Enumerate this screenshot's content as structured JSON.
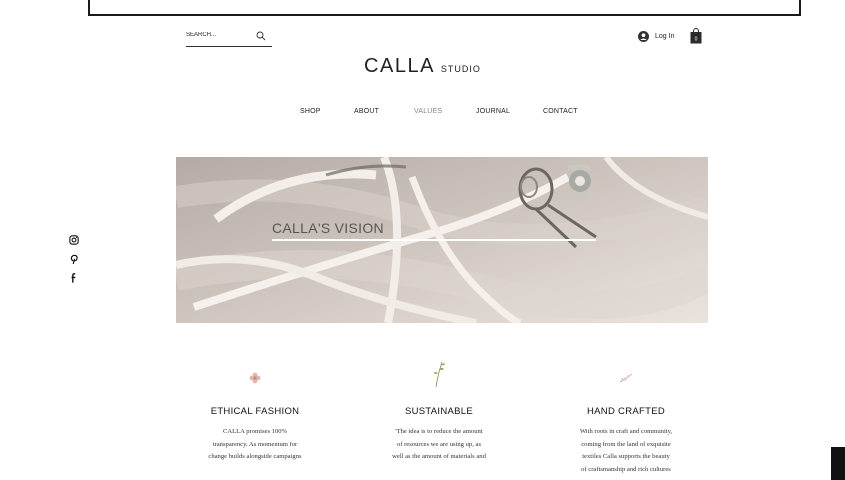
{
  "header": {
    "search_placeholder": "SEARCH...",
    "logo_main": "CALLA",
    "logo_sub": "STUDIO",
    "login_label": "Log In",
    "cart_count": "0"
  },
  "nav": {
    "items": [
      {
        "label": "SHOP"
      },
      {
        "label": "ABOUT"
      },
      {
        "label": "VALUES"
      },
      {
        "label": "JOURNAL"
      },
      {
        "label": "CONTACT"
      }
    ],
    "active_item": "VALUES",
    "active_color": "#7a8d84"
  },
  "social": {
    "icons": [
      "instagram-icon",
      "pinterest-icon",
      "facebook-icon"
    ]
  },
  "hero": {
    "caption": "CALLA'S VISION"
  },
  "values": [
    {
      "icon": "flower-icon",
      "title": "ETHICAL FASHION",
      "lines": [
        "CALLA promises 100%",
        "transparency. As momentum for",
        "change builds alongside campaigns"
      ]
    },
    {
      "icon": "leaf-sprig-icon",
      "title": "SUSTAINABLE",
      "lines": [
        "'The idea is to reduce the amount",
        "of resources we are using up, as",
        "well as the amount of materials and"
      ]
    },
    {
      "icon": "blossom-sprig-icon",
      "title": "HAND CRAFTED",
      "lines": [
        "With roots in craft and community,",
        "coming from the land of exquisite",
        "textiles Calla supports the beauty",
        "of craftsmanship and rich cultures"
      ]
    }
  ]
}
